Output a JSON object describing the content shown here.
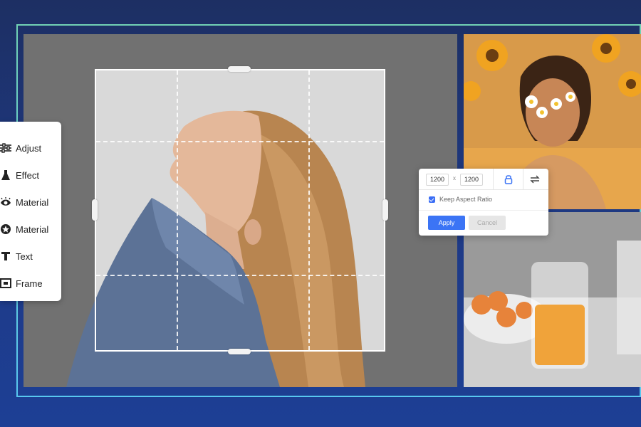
{
  "tools": [
    {
      "icon": "sliders-icon",
      "label": "Adjust"
    },
    {
      "icon": "flask-icon",
      "label": "Effect"
    },
    {
      "icon": "eye-icon",
      "label": "Material"
    },
    {
      "icon": "star-icon",
      "label": "Material"
    },
    {
      "icon": "text-icon",
      "label": "Text"
    },
    {
      "icon": "frame-icon",
      "label": "Frame"
    }
  ],
  "dialog": {
    "width_value": "1200",
    "height_value": "1200",
    "separator": "x",
    "lock_icon": "lock-icon",
    "swap_icon": "swap-icon",
    "keep_aspect_label": "Keep Aspect Ratio",
    "keep_aspect_checked": true,
    "apply_label": "Apply",
    "cancel_label": "Cancel"
  },
  "colors": {
    "accent": "#3b74f5",
    "frame_line": "#5fd0e8",
    "background": "#1e3a86"
  }
}
